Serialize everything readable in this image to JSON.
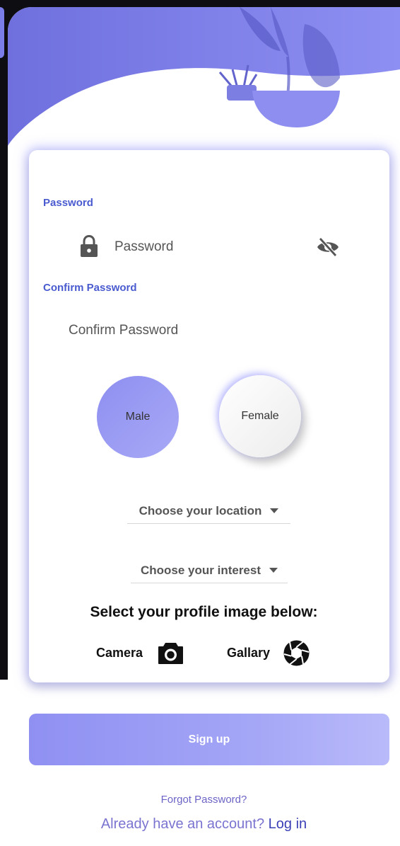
{
  "form": {
    "password_label": "Password",
    "password_placeholder": "Password",
    "confirm_label": "Confirm Password",
    "confirm_placeholder": "Confirm Password"
  },
  "gender": {
    "male": "Male",
    "female": "Female",
    "selected": "Female"
  },
  "dropdowns": {
    "location": "Choose your location",
    "interest": "Choose your interest"
  },
  "profile": {
    "title": "Select your profile image below:",
    "camera": "Camera",
    "gallery": "Gallary"
  },
  "actions": {
    "signup": "Sign up",
    "forgot": "Forgot Password?",
    "already": "Already have an account?",
    "login": "Log in"
  },
  "colors": {
    "accent": "#7b7de8",
    "label": "#4a5bd0",
    "link": "#3b3fb6"
  },
  "icons": {
    "lock": "lock-icon",
    "eye": "eye-off-icon",
    "camera": "camera-icon",
    "gallery": "aperture-icon"
  }
}
